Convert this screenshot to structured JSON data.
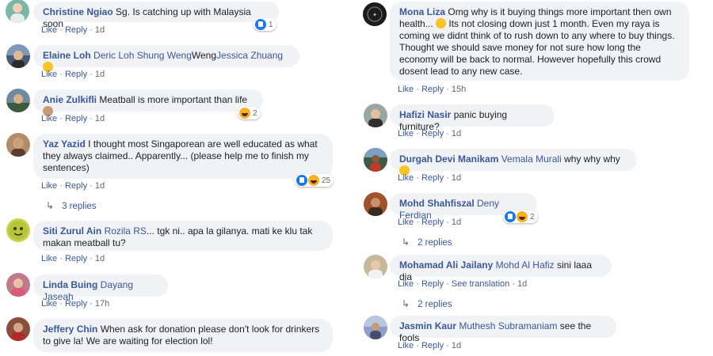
{
  "left": [
    {
      "author": "Christine Ngiao",
      "mentions": [],
      "text": "Sg. Is catching up with Malaysia soon",
      "emoji": "",
      "like": "Like",
      "reply": "Reply",
      "extra": "",
      "time": "1d",
      "reactions": {
        "types": [
          "like"
        ],
        "count": "1"
      },
      "replies": ""
    },
    {
      "author": "Elaine Loh",
      "mentions": [
        "Deric Loh Shung Weng",
        "Jessica Zhuang"
      ],
      "text": "Weng",
      "emoji": "slightly-smiling-face",
      "like": "Like",
      "reply": "Reply",
      "extra": "",
      "time": "1d",
      "reactions": null,
      "replies": ""
    },
    {
      "author": "Anie Zulkifli",
      "mentions": [],
      "text": "Meatball is more important than life",
      "emoji": "person-gesturing",
      "like": "Like",
      "reply": "Reply",
      "extra": "",
      "time": "1d",
      "reactions": {
        "types": [
          "haha"
        ],
        "count": "2"
      },
      "replies": ""
    },
    {
      "author": "Yaz Yazid",
      "mentions": [],
      "text": "I thought most Singaporean are well educated as what they always claimed.. Apparently... (please help me to finish my sentences)",
      "emoji": "",
      "like": "Like",
      "reply": "Reply",
      "extra": "",
      "time": "1d",
      "reactions": {
        "types": [
          "like",
          "haha"
        ],
        "count": "25"
      },
      "replies": "3 replies"
    },
    {
      "author": "Siti Zurul Ain",
      "mentions": [
        "Rozila RS"
      ],
      "text": "... tgk ni.. apa la gilanya. mati ke klu tak makan meatball tu?",
      "emoji": "",
      "like": "Like",
      "reply": "Reply",
      "extra": "",
      "time": "1d",
      "reactions": null,
      "replies": ""
    },
    {
      "author": "Linda Buing",
      "mentions": [
        "Dayang Jaseah"
      ],
      "text": "",
      "emoji": "",
      "like": "Like",
      "reply": "Reply",
      "extra": "",
      "time": "17h",
      "reactions": null,
      "replies": ""
    },
    {
      "author": "Jeffery Chin",
      "mentions": [],
      "text": "When ask for donation please don't look for drinkers to give la! We are waiting for election lol!",
      "emoji": "",
      "like": "",
      "reply": "",
      "extra": "",
      "time": "",
      "reactions": null,
      "replies": ""
    }
  ],
  "right": [
    {
      "author": "Mona Liza",
      "mentions": [],
      "text": "Omg why is it buying things more important then own health...",
      "text2": "Its not closing down just 1 month. Even my raya is coming we didnt think of to rush down to any where to buy things. Thought we should save money for not sure how long the economy will be back to normal. However hopefully this crowd dosent lead to any new case.",
      "emoji": "worried-face",
      "like": "Like",
      "reply": "Reply",
      "extra": "",
      "time": "15h",
      "reactions": null,
      "replies": ""
    },
    {
      "author": "Hafizi Nasir",
      "mentions": [],
      "text": "panic buying furniture?",
      "emoji": "",
      "like": "Like",
      "reply": "Reply",
      "extra": "",
      "time": "1d",
      "reactions": null,
      "replies": ""
    },
    {
      "author": "Durgah Devi Manikam",
      "mentions": [
        "Vemala Murali"
      ],
      "text": "why why why",
      "emoji": "grimacing-face",
      "like": "Like",
      "reply": "Reply",
      "extra": "",
      "time": "1d",
      "reactions": null,
      "replies": ""
    },
    {
      "author": "Mohd Shahfiszal",
      "mentions": [
        "Deny Ferdian"
      ],
      "text": "",
      "emoji": "",
      "like": "Like",
      "reply": "Reply",
      "extra": "",
      "time": "1d",
      "reactions": {
        "types": [
          "like",
          "haha"
        ],
        "count": "2"
      },
      "replies": "2 replies"
    },
    {
      "author": "Mohamad Ali Jailany",
      "mentions": [
        "Mohd Al Hafiz"
      ],
      "text": "sini laaa dia",
      "emoji": "",
      "like": "Like",
      "reply": "Reply",
      "extra": "See translation",
      "time": "1d",
      "reactions": null,
      "replies": "2 replies"
    },
    {
      "author": "Jasmin Kaur",
      "mentions": [
        "Muthesh Subramaniam"
      ],
      "text": "see the fools",
      "emoji": "",
      "like": "Like",
      "reply": "Reply",
      "extra": "",
      "time": "1d",
      "reactions": null,
      "replies": ""
    }
  ],
  "avatar_colors": {
    "left": [
      "#7ab7a5",
      "#4a5a78",
      "#6f8aa0",
      "#b38c6a",
      "#c9d24a",
      "#c07a8a",
      "#8a4f3a"
    ],
    "right": [
      "#202020",
      "#9aa7a0",
      "#3e5a40",
      "#a0522d",
      "#c8b89a",
      "#8fa0c8"
    ]
  }
}
